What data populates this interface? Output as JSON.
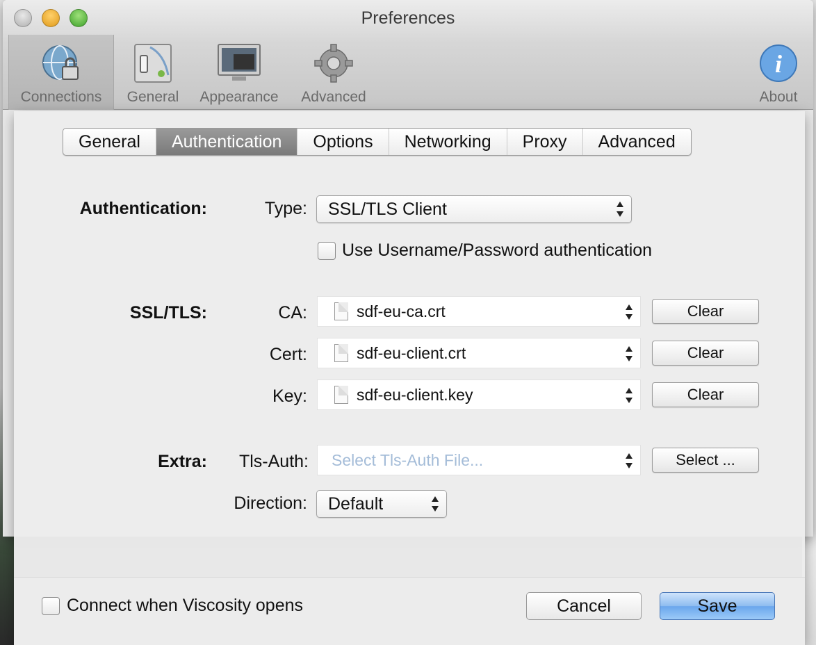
{
  "window": {
    "title": "Preferences"
  },
  "toolbar": {
    "connections": "Connections",
    "general": "General",
    "appearance": "Appearance",
    "advanced": "Advanced",
    "about": "About"
  },
  "tabs": [
    "General",
    "Authentication",
    "Options",
    "Networking",
    "Proxy",
    "Advanced"
  ],
  "auth": {
    "section": "Authentication:",
    "type_label": "Type:",
    "type_value": "SSL/TLS Client",
    "use_userpass": "Use Username/Password authentication"
  },
  "ssl": {
    "section": "SSL/TLS:",
    "ca_label": "CA:",
    "ca_value": "sdf-eu-ca.crt",
    "cert_label": "Cert:",
    "cert_value": "sdf-eu-client.crt",
    "key_label": "Key:",
    "key_value": "sdf-eu-client.key",
    "clear": "Clear"
  },
  "extra": {
    "section": "Extra:",
    "tls_label": "Tls-Auth:",
    "tls_placeholder": "Select Tls-Auth File...",
    "select": "Select ...",
    "direction_label": "Direction:",
    "direction_value": "Default"
  },
  "footer": {
    "connect_on_open": "Connect when Viscosity opens",
    "cancel": "Cancel",
    "save": "Save"
  },
  "colors": {
    "save_button": "#8ebcf0",
    "active_tab": "#8a8a8a"
  }
}
